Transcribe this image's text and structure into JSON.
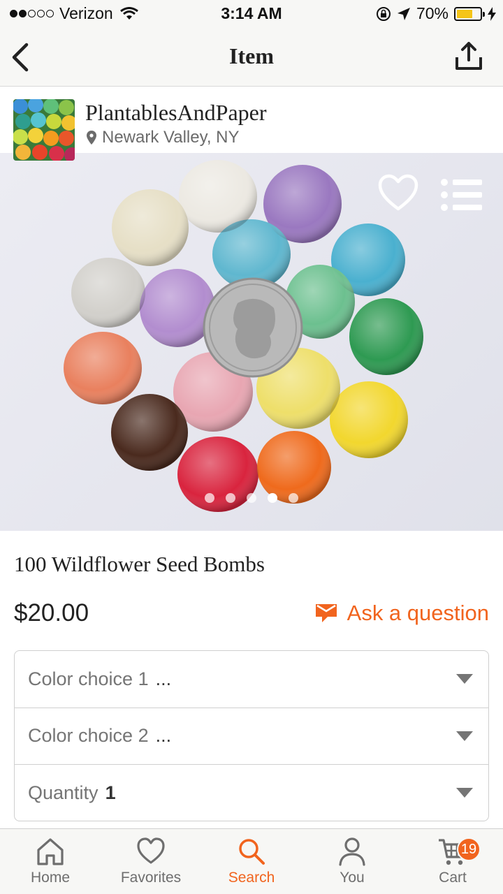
{
  "status_bar": {
    "carrier": "Verizon",
    "time": "3:14 AM",
    "battery": "70%",
    "battery_level": 0.7
  },
  "nav": {
    "title": "Item",
    "back_icon": "chevron-left-icon",
    "share_icon": "share-icon"
  },
  "shop": {
    "name": "PlantablesAndPaper",
    "location": "Newark Valley, NY"
  },
  "gallery": {
    "image_count": 5,
    "active_index": 3
  },
  "item": {
    "title": "100 Wildflower Seed Bombs",
    "price": "$20.00",
    "ask_label": "Ask a question"
  },
  "options": [
    {
      "label": "Color choice 1",
      "value": "..."
    },
    {
      "label": "Color choice 2",
      "value": "..."
    },
    {
      "label": "Quantity",
      "value": "1"
    }
  ],
  "tabs": [
    {
      "label": "Home",
      "icon": "home-icon"
    },
    {
      "label": "Favorites",
      "icon": "heart-icon"
    },
    {
      "label": "Search",
      "icon": "search-icon",
      "active": true
    },
    {
      "label": "You",
      "icon": "person-icon"
    },
    {
      "label": "Cart",
      "icon": "cart-icon",
      "badge": "19"
    }
  ],
  "colors": {
    "accent": "#f1641e",
    "battery": "#f5c518"
  }
}
